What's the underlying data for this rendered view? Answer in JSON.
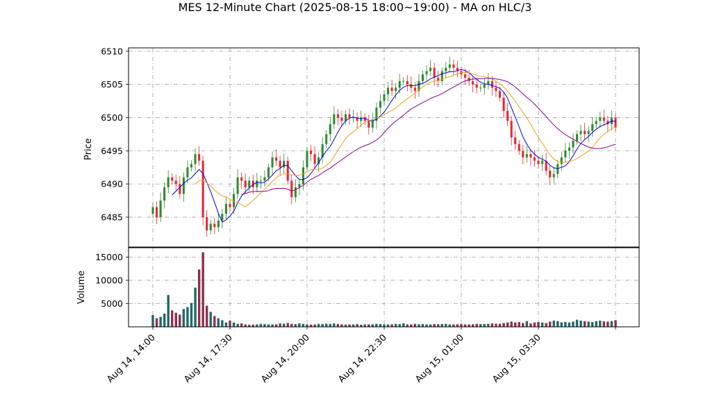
{
  "chart_data": {
    "type": "candlestick",
    "title": "MES 12-Minute Chart (2025-08-15 18:00~19:00) - MA on HLC/3",
    "price_panel": {
      "ylabel": "Price",
      "ylim": [
        6480.5,
        6510.5
      ],
      "yticks": [
        6485,
        6490,
        6495,
        6500,
        6505,
        6510
      ],
      "grid": true
    },
    "volume_panel": {
      "ylabel": "Volume",
      "ylim": [
        0,
        17000
      ],
      "yticks": [
        5000,
        10000,
        15000
      ],
      "grid": true
    },
    "x_axis": {
      "tick_labels": [
        "Aug 14, 14:00",
        "Aug 14, 17:30",
        "Aug 14, 20:00",
        "Aug 14, 22:30",
        "Aug 15, 01:00",
        "Aug 15, 03:30",
        ""
      ],
      "tick_index": [
        0,
        20,
        40,
        60,
        80,
        100,
        120
      ],
      "bar_count": 121
    },
    "colors": {
      "up": "#2e8b2e",
      "down": "#e8262f",
      "vol_up": "#1a6f6f",
      "vol_down": "#9c2a4e",
      "ma_fast": "#0000dd",
      "ma_mid": "#f0a020",
      "ma_slow": "#880088",
      "grid": "#a0a0a0"
    },
    "series": [
      {
        "name": "close",
        "values": [
          6486.5,
          6485.0,
          6487.5,
          6489.5,
          6491.0,
          6490.5,
          6490.0,
          6488.5,
          6491.0,
          6492.5,
          6493.0,
          6494.5,
          6493.5,
          6485.0,
          6483.0,
          6484.0,
          6483.5,
          6484.5,
          6485.5,
          6487.0,
          6486.5,
          6488.5,
          6491.0,
          6490.5,
          6489.5,
          6490.5,
          6489.5,
          6490.5,
          6490.5,
          6491.0,
          6492.5,
          6494.0,
          6493.5,
          6492.5,
          6493.5,
          6490.5,
          6488.0,
          6489.5,
          6490.0,
          6492.5,
          6495.0,
          6494.5,
          6493.0,
          6494.0,
          6496.0,
          6497.5,
          6499.0,
          6500.5,
          6500.0,
          6499.5,
          6500.5,
          6500.0,
          6500.0,
          6499.5,
          6500.0,
          6499.5,
          6498.5,
          6499.5,
          6501.5,
          6502.5,
          6503.5,
          6504.5,
          6504.0,
          6504.5,
          6505.5,
          6505.5,
          6505.0,
          6504.5,
          6504.0,
          6505.5,
          6506.5,
          6507.0,
          6507.5,
          6506.0,
          6505.5,
          6507.0,
          6507.5,
          6508.0,
          6507.5,
          6507.0,
          6506.5,
          6506.0,
          6505.5,
          6505.0,
          6504.5,
          6504.5,
          6505.0,
          6505.5,
          6504.5,
          6504.0,
          6503.0,
          6501.0,
          6499.5,
          6497.0,
          6496.0,
          6495.0,
          6494.0,
          6494.5,
          6494.0,
          6493.5,
          6493.0,
          6493.5,
          6492.0,
          6491.0,
          6491.5,
          6493.0,
          6494.0,
          6495.0,
          6495.5,
          6496.5,
          6497.5,
          6498.0,
          6497.5,
          6498.0,
          6499.0,
          6499.5,
          6500.0,
          6499.5,
          6499.0,
          6500.0,
          6498.5
        ]
      },
      {
        "name": "volume",
        "values": [
          2500,
          1800,
          2100,
          2800,
          6800,
          3500,
          3000,
          2600,
          3800,
          4200,
          5100,
          8400,
          12300,
          16000,
          4500,
          3200,
          2300,
          1800,
          1400,
          900,
          1300,
          900,
          600,
          700,
          500,
          400,
          450,
          500,
          600,
          550,
          500,
          480,
          520,
          700,
          650,
          800,
          600,
          550,
          700,
          600,
          500,
          450,
          480,
          600,
          550,
          650,
          600,
          700,
          550,
          500,
          450,
          480,
          500,
          550,
          420,
          480,
          500,
          520,
          600,
          550,
          500,
          480,
          520,
          600,
          550,
          700,
          500,
          480,
          600,
          520,
          560,
          500,
          480,
          550,
          520,
          580,
          600,
          500,
          480,
          520,
          550,
          500,
          480,
          520,
          600,
          550,
          580,
          600,
          700,
          620,
          650,
          780,
          900,
          1100,
          900,
          1000,
          800,
          1200,
          700,
          900,
          1000,
          900,
          800,
          1100,
          1300,
          1200,
          950,
          1000,
          900,
          1100,
          1500,
          1300,
          1200,
          1100,
          1000,
          1200,
          1300,
          1150,
          1100,
          1200,
          1400
        ]
      }
    ]
  }
}
